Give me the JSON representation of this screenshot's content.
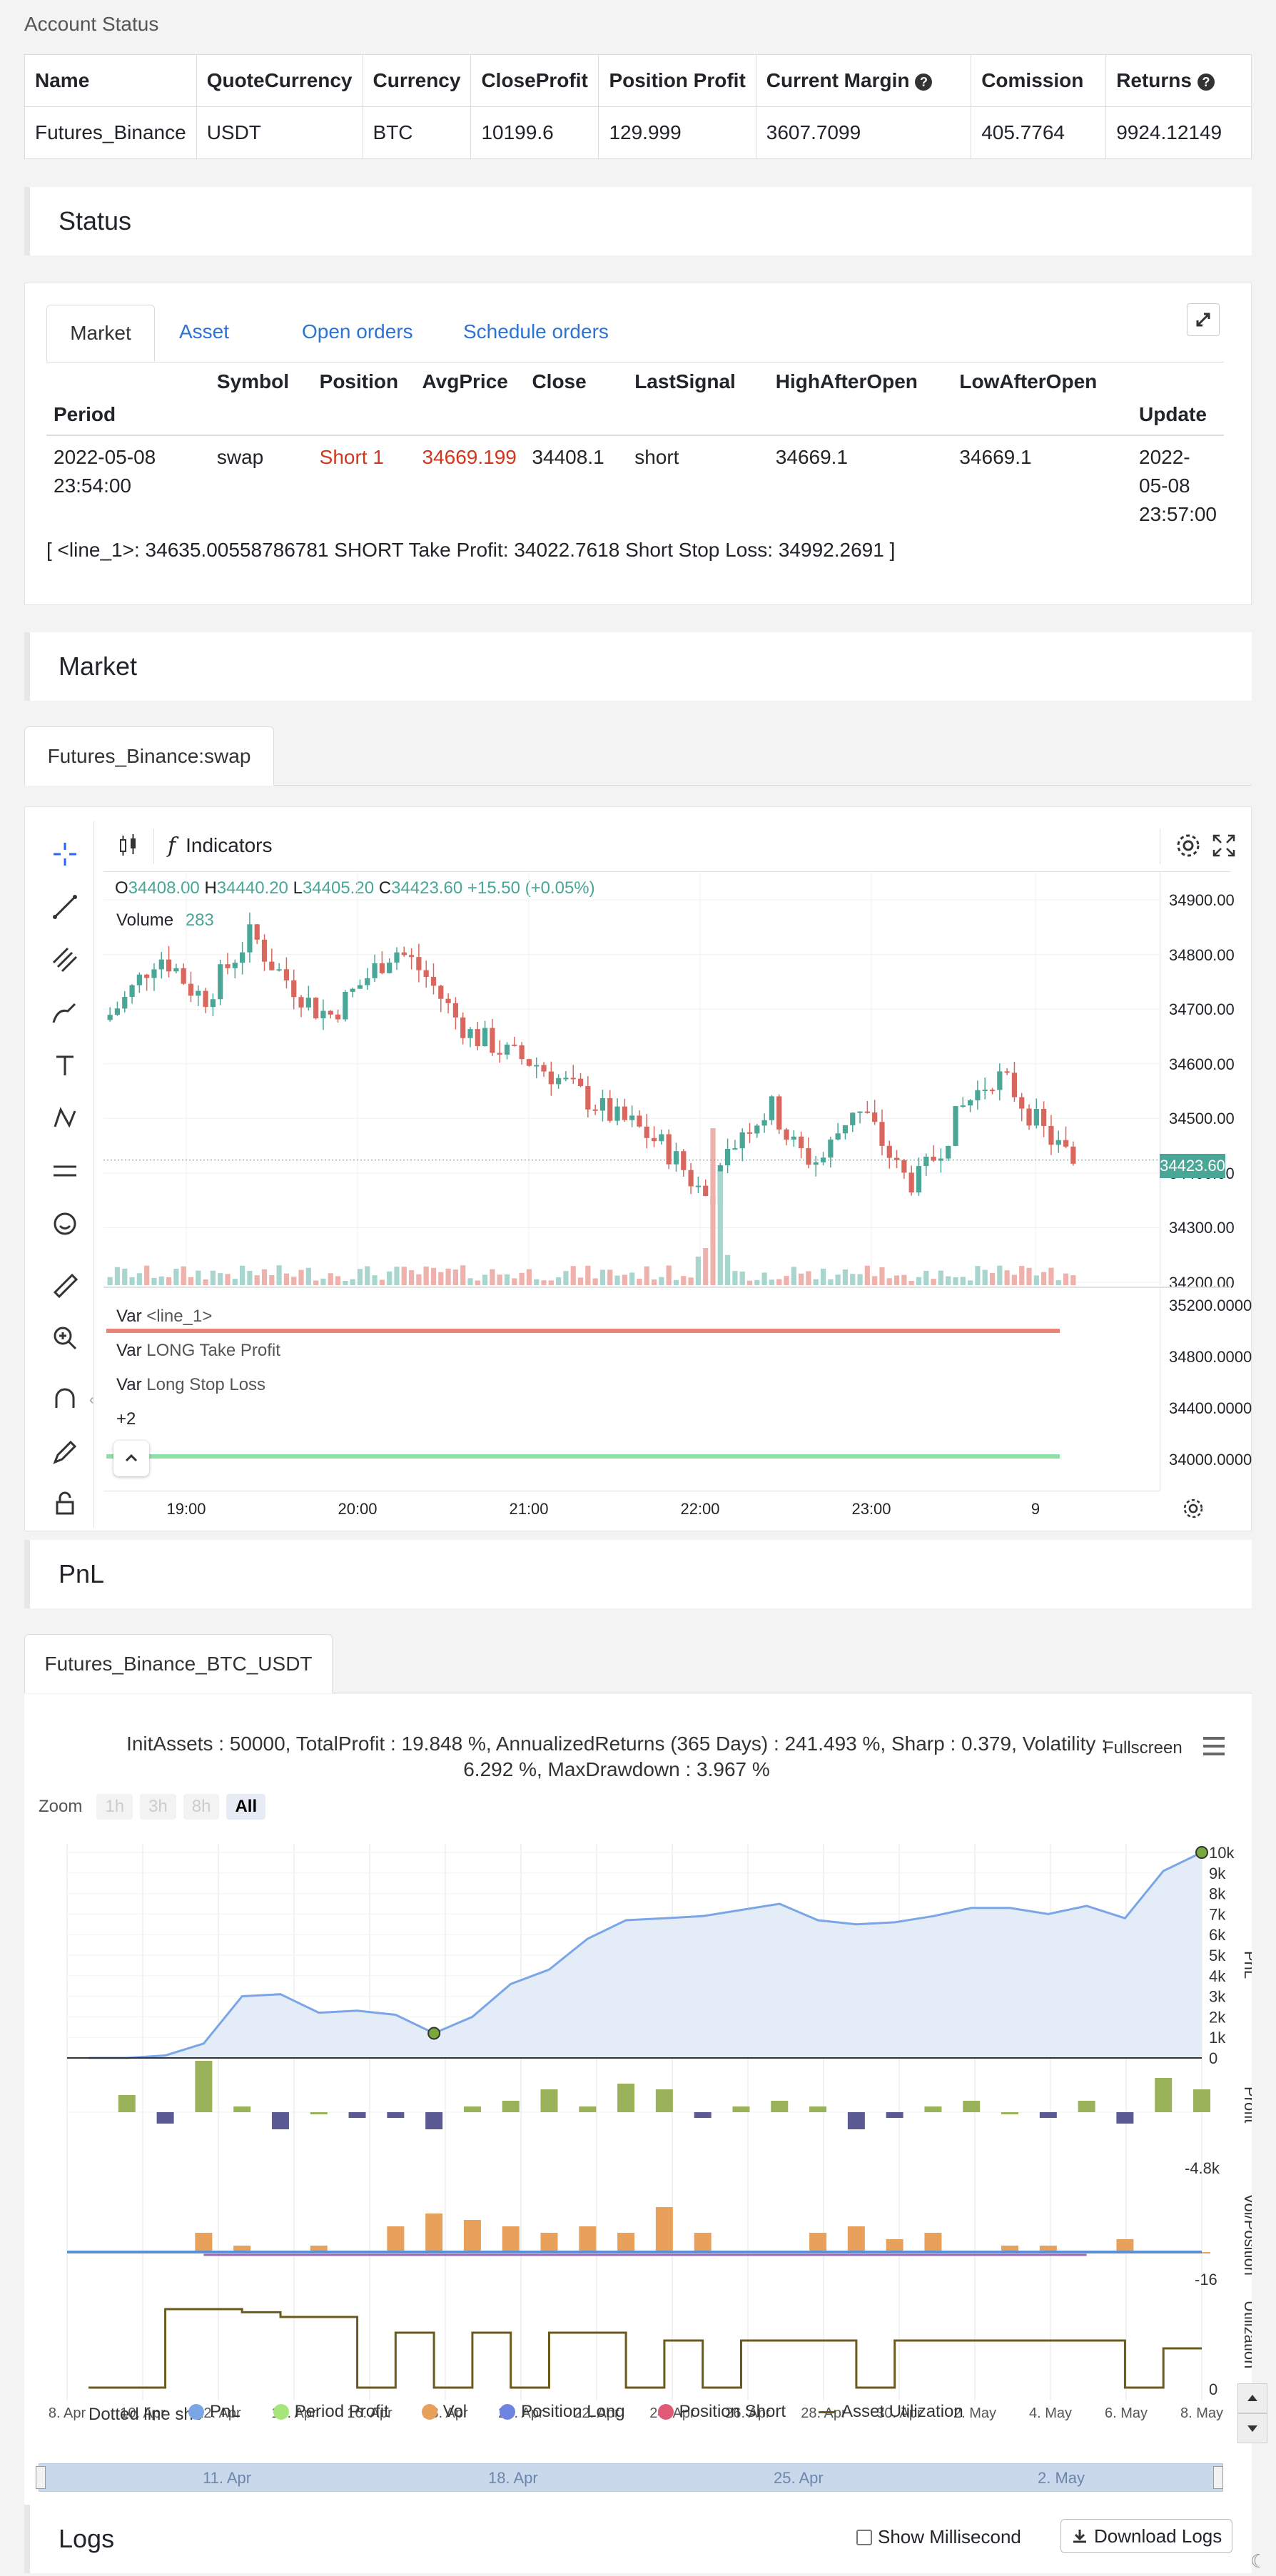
{
  "account": {
    "heading": "Account Status",
    "columns": [
      "Name",
      "QuoteCurrency",
      "Currency",
      "CloseProfit",
      "Position Profit",
      "Current Margin",
      "Comission",
      "Returns"
    ],
    "row": [
      "Futures_Binance",
      "USDT",
      "BTC",
      "10199.6",
      "129.999",
      "3607.7099",
      "405.7764",
      "9924.12149"
    ]
  },
  "status": {
    "heading": "Status",
    "tabs": [
      "Market",
      "Asset",
      "Open orders",
      "Schedule orders"
    ],
    "columns": [
      "Period",
      "Symbol",
      "Position",
      "AvgPrice",
      "Close",
      "LastSignal",
      "HighAfterOpen",
      "LowAfterOpen",
      "Update"
    ],
    "row": {
      "period_date": "2022-05-08",
      "period_time": "23:54:00",
      "symbol": "swap",
      "position": "Short 1",
      "avg_price": "34669.199",
      "close": "34408.1",
      "last_signal": "short",
      "high_after_open": "34669.1",
      "low_after_open": "34669.1",
      "update_date": "2022-05-08",
      "update_time": "23:57:00"
    },
    "note": "[ <line_1>: 34635.00558786781 SHORT Take Profit: 34022.7618 Short Stop Loss: 34992.2691 ]"
  },
  "market": {
    "heading": "Market",
    "tab": "Futures_Binance:swap",
    "toolbar": {
      "indicators_label": "Indicators"
    },
    "ohlc": {
      "o_label": "O",
      "o": "34408.00",
      "h_label": "H",
      "h": "34440.20",
      "l_label": "L",
      "l": "34405.20",
      "c_label": "C",
      "c": "34423.60",
      "change": "+15.50 (+0.05%)"
    },
    "volume": {
      "label": "Volume",
      "value": "283"
    },
    "price_ticks": [
      "34900.00",
      "34800.00",
      "34700.00",
      "34600.00",
      "34500.00",
      "34400.00",
      "34300.00",
      "34200.00"
    ],
    "current_price": "34423.60",
    "indicator_ticks": [
      "35200.0000",
      "34800.0000",
      "34400.0000",
      "34000.0000"
    ],
    "vars": [
      {
        "prefix": "Var",
        "name": "<line_1>"
      },
      {
        "prefix": "Var",
        "name": "LONG Take Profit"
      },
      {
        "prefix": "Var",
        "name": "Long Stop Loss"
      }
    ],
    "more_vars": "+2",
    "time_ticks": [
      "19:00",
      "20:00",
      "21:00",
      "22:00",
      "23:00",
      "9"
    ],
    "up_color": "#4aa697",
    "down_color": "#d9675d"
  },
  "pnl": {
    "heading": "PnL",
    "tab": "Futures_Binance_BTC_USDT",
    "summary_line1": "InitAssets : 50000, TotalProfit : 19.848 %, AnnualizedReturns (365 Days) : 241.493 %, Sharp : 0.379, Volatility :",
    "summary_line2": "6.292 %, MaxDrawdown : 3.967 %",
    "fullscreen_label": "Fullscreen",
    "zoom_label": "Zoom",
    "zoom_options": [
      "1h",
      "3h",
      "8h",
      "All"
    ],
    "pnl_ticks": [
      "10k",
      "9k",
      "8k",
      "7k",
      "6k",
      "5k",
      "4k",
      "3k",
      "2k",
      "1k",
      "0"
    ],
    "axis_titles": [
      "PnL",
      "Profit",
      "Vol/Position",
      "Utilization"
    ],
    "profit_min_label": "-4.8k",
    "vol_min_label": "-16",
    "util_tick": "0",
    "date_ticks": [
      "8. Apr",
      "10. Apr",
      "12. Apr",
      "14. Apr",
      "16. Apr",
      "18. Apr",
      "20. Apr",
      "22. Apr",
      "24. Apr",
      "26. Apr",
      "28. Apr",
      "30. Apr",
      "2. May",
      "4. May",
      "6. May",
      "8. May"
    ],
    "legend": [
      {
        "label": "PnL",
        "color": "#7aa5e6"
      },
      {
        "label": "Period Profit",
        "color": "#a6e57a"
      },
      {
        "label": "Vol",
        "color": "#e8a05a"
      },
      {
        "label": "Position Long",
        "color": "#6f83e0"
      },
      {
        "label": "Position Short",
        "color": "#e05a78"
      },
      {
        "label": "Asset Utilization",
        "color": "#6b5a1e"
      }
    ],
    "legend_prefix": "Dotted line sho",
    "navigator_ticks": [
      "11. Apr",
      "18. Apr",
      "25. Apr",
      "2. May"
    ]
  },
  "logs": {
    "heading": "Logs",
    "millisecond_label": "Show Millisecond",
    "download_label": "Download Logs"
  }
}
